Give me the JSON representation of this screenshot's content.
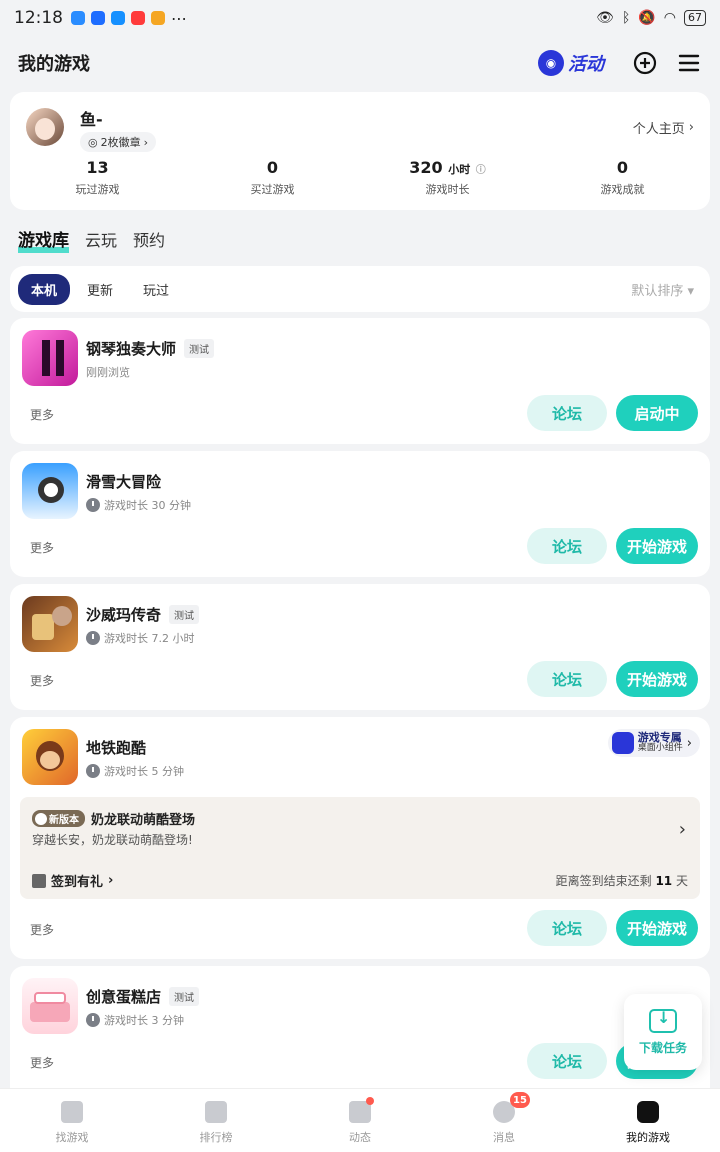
{
  "status_bar": {
    "time": "12:18",
    "battery": "67"
  },
  "header": {
    "title": "我的游戏",
    "activity_label": "活动"
  },
  "profile": {
    "username": "鱼-",
    "medals": "2枚徽章",
    "homepage_link": "个人主页",
    "stats": [
      {
        "value": "13",
        "unit": "",
        "label": "玩过游戏"
      },
      {
        "value": "0",
        "unit": "",
        "label": "买过游戏"
      },
      {
        "value": "320",
        "unit": "小时",
        "label": "游戏时长"
      },
      {
        "value": "0",
        "unit": "",
        "label": "游戏成就"
      }
    ]
  },
  "section_tabs": [
    "游戏库",
    "云玩",
    "预约"
  ],
  "filter": {
    "chips": [
      "本机",
      "更新",
      "玩过"
    ],
    "sort_label": "默认排序"
  },
  "games": [
    {
      "name": "钢琴独奏大师",
      "tag": "测试",
      "sub": "刚刚浏览",
      "more": "更多",
      "forum": "论坛",
      "action": "启动中"
    },
    {
      "name": "滑雪大冒险",
      "tag": "",
      "sub": "游戏时长 30 分钟",
      "more": "更多",
      "forum": "论坛",
      "action": "开始游戏"
    },
    {
      "name": "沙威玛传奇",
      "tag": "测试",
      "sub": "游戏时长 7.2 小时",
      "more": "更多",
      "forum": "论坛",
      "action": "开始游戏"
    },
    {
      "name": "地铁跑酷",
      "tag": "",
      "sub": "游戏时长 5 分钟",
      "more": "更多",
      "forum": "论坛",
      "action": "开始游戏",
      "widget_title": "游戏专属",
      "widget_sub": "桌面小组件",
      "news_tag": "新版本",
      "news_title": "奶龙联动萌酷登场",
      "news_desc": "穿越长安，奶龙联动萌酷登场!",
      "signin_label": "签到有礼",
      "signin_prefix": "距离签到结束还剩",
      "signin_days": "11",
      "signin_suffix": "天"
    },
    {
      "name": "创意蛋糕店",
      "tag": "测试",
      "sub": "游戏时长 3 分钟",
      "more": "更多",
      "forum": "论坛",
      "action": "开始游戏"
    }
  ],
  "float_download": {
    "label": "下载任务"
  },
  "bottom_nav": [
    {
      "label": "找游戏"
    },
    {
      "label": "排行榜"
    },
    {
      "label": "动态"
    },
    {
      "label": "消息",
      "badge": "15"
    },
    {
      "label": "我的游戏"
    }
  ]
}
